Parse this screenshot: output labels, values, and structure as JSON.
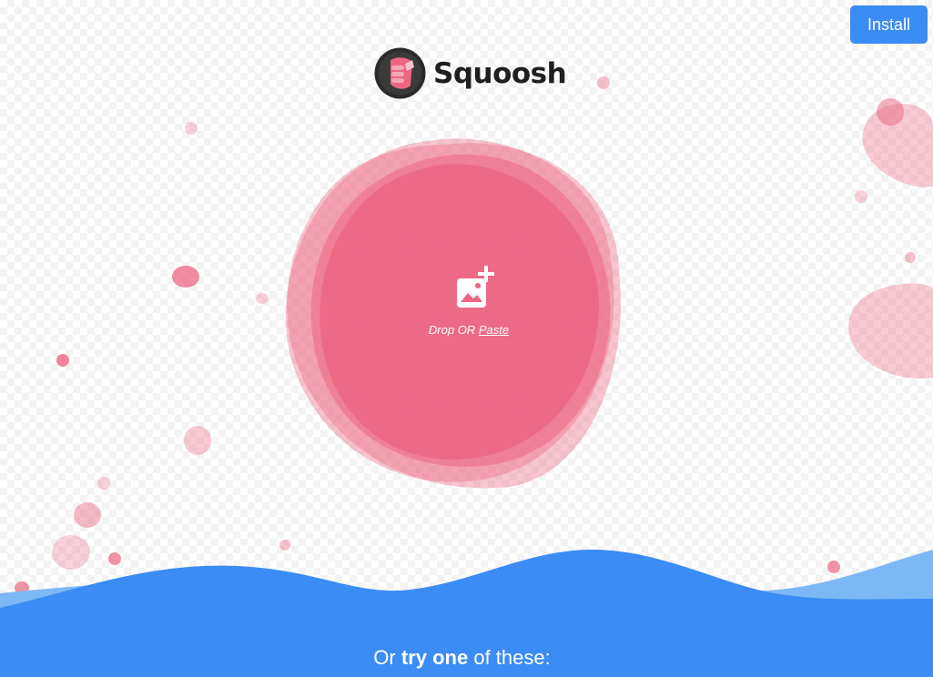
{
  "app": {
    "name": "Squoosh"
  },
  "header": {
    "install_label": "Install"
  },
  "drop_zone": {
    "drop_label": "Drop OR",
    "paste_label": "Paste"
  },
  "demos": {
    "heading_prefix": "Or",
    "heading_bold": "try one",
    "heading_suffix": "of these:"
  },
  "colors": {
    "accent_pink": "#ec6683",
    "accent_blue": "#3b8cf4",
    "light_blue": "#7cb8f5",
    "logo_dark": "#1f1f1f"
  },
  "icons": {
    "logo": "squoosh-logo-icon",
    "add_image": "add-image-icon"
  }
}
